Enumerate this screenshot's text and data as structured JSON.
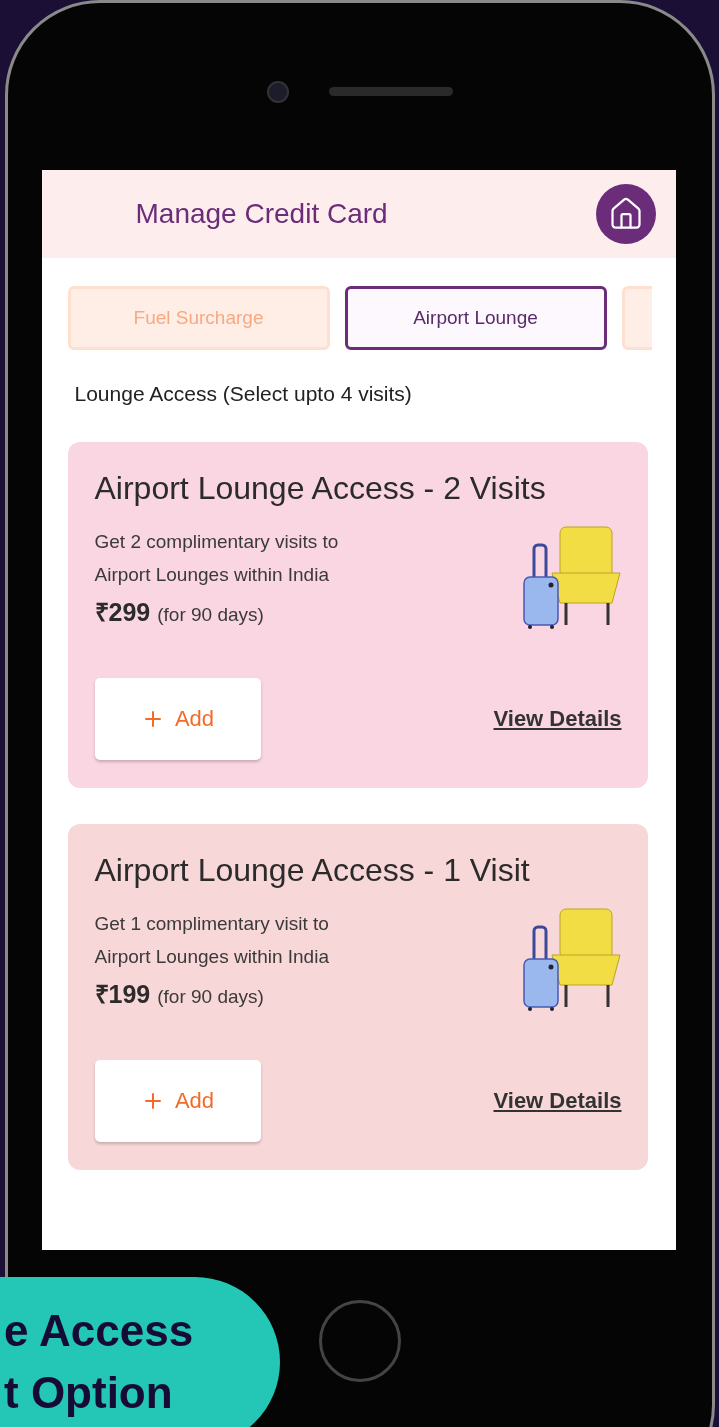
{
  "header": {
    "title": "Manage Credit Card"
  },
  "tabs": [
    {
      "label": "Fuel Surcharge",
      "selected": false
    },
    {
      "label": "Airport Lounge",
      "selected": true
    },
    {
      "selected": false
    }
  ],
  "section_label": "Lounge Access (Select upto 4 visits)",
  "offers": [
    {
      "title": "Airport Lounge Access - 2 Visits",
      "description": [
        "Get 2 complimentary visits to",
        "Airport Lounges within India"
      ],
      "price": "₹299",
      "period": "(for 90 days)",
      "add_label": "Add",
      "details_link": "View Details",
      "color": "#f9d6e2"
    },
    {
      "title": "Airport Lounge Access - 1 Visit",
      "description": [
        "Get 1 complimentary visit to",
        "Airport Lounges within India"
      ],
      "price": "₹199",
      "period": "(for 90 days)",
      "add_label": "Add",
      "details_link": "View Details",
      "color": "#f8d7d8"
    }
  ],
  "banner": {
    "lines": [
      "e Access",
      "t Option"
    ]
  }
}
